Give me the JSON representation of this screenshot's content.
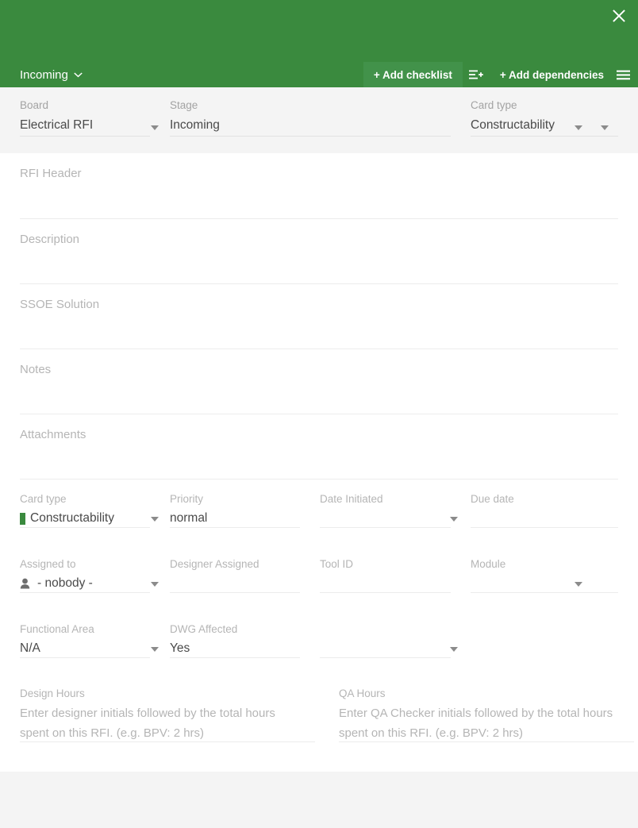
{
  "colors": {
    "brand_green": "#3a8a3e",
    "brand_green_light": "#42924a",
    "card_type_swatch": "#3a8a3e",
    "label_gray": "#b5b5b5",
    "value_gray": "#4a4a4a",
    "strip_bg": "#f4f4f4"
  },
  "header": {
    "close_label": "close-icon",
    "stage_chip": {
      "label": "Incoming",
      "caret": "⌄"
    },
    "buttons": [
      {
        "label": "+ Add checklist",
        "name": "add-checklist-button",
        "highlighted": true
      },
      {
        "label": "+ Add dependencies",
        "name": "add-dependencies-button",
        "highlighted": false
      }
    ],
    "icons": [
      {
        "name": "add-subtask-icon",
        "glyph": "≡+"
      },
      {
        "name": "hamburger-menu-icon",
        "glyph": "≡"
      }
    ]
  },
  "selectors": [
    {
      "label": "Board",
      "value": "Electrical RFI",
      "name": "board-select",
      "caret": true
    },
    {
      "label": "Stage",
      "value": "Incoming",
      "name": "stage-select",
      "caret": true
    },
    {
      "label": "Card type",
      "value": "Constructability",
      "name": "card-type-select-top",
      "caret": true
    }
  ],
  "text_blocks": [
    {
      "label": "RFI Header",
      "name": "rfi-header-field",
      "value": ""
    },
    {
      "label": "Description",
      "name": "description-field",
      "value": ""
    },
    {
      "label": "SSOE Solution",
      "name": "ssoe-solution-field",
      "value": ""
    },
    {
      "label": "Notes",
      "name": "notes-field",
      "value": ""
    },
    {
      "label": "Attachments",
      "name": "attachments-field",
      "value": ""
    }
  ],
  "field_rows": [
    {
      "row_name": "row-card-type-priority",
      "cells": [
        {
          "label": "Card type",
          "value": "Constructability",
          "name": "card-type-field",
          "caret": true,
          "swatch": true
        },
        {
          "label": "Priority",
          "value": "normal",
          "name": "priority-field",
          "caret": true
        },
        {
          "label": "Date Initiated",
          "value": "",
          "name": "date-initiated-field",
          "caret": false
        },
        {
          "label": "Due date",
          "value": "",
          "name": "due-date-field",
          "caret": false
        }
      ]
    },
    {
      "row_name": "row-assignment",
      "cells": [
        {
          "label": "Assigned to",
          "value": "- nobody -",
          "name": "assigned-to-field",
          "caret": true,
          "person": true
        },
        {
          "label": "Designer Assigned",
          "value": "",
          "name": "designer-assigned-field",
          "caret": false
        },
        {
          "label": "Tool ID",
          "value": "",
          "name": "tool-id-field",
          "caret": false
        },
        {
          "label": "Module",
          "value": "",
          "name": "module-field",
          "caret": true
        }
      ]
    },
    {
      "row_name": "row-functional-area",
      "cells": [
        {
          "label": "Functional Area",
          "value": "N/A",
          "name": "functional-area-field",
          "caret": true
        },
        {
          "label": "DWG Affected",
          "value": "Yes",
          "name": "dwg-affected-field",
          "caret": true
        },
        {
          "label": "",
          "value": "",
          "name": "blank-field",
          "caret": false
        }
      ]
    }
  ],
  "hours": [
    {
      "label": "Design Hours",
      "name": "design-hours-field",
      "placeholder": "Enter designer initials followed by the total hours spent on this RFI. (e.g. BPV: 2 hrs)",
      "value": ""
    },
    {
      "label": "QA Hours",
      "name": "qa-hours-field",
      "placeholder": "Enter QA Checker initials followed by the total hours spent on this RFI. (e.g. BPV: 2 hrs)",
      "value": ""
    }
  ]
}
